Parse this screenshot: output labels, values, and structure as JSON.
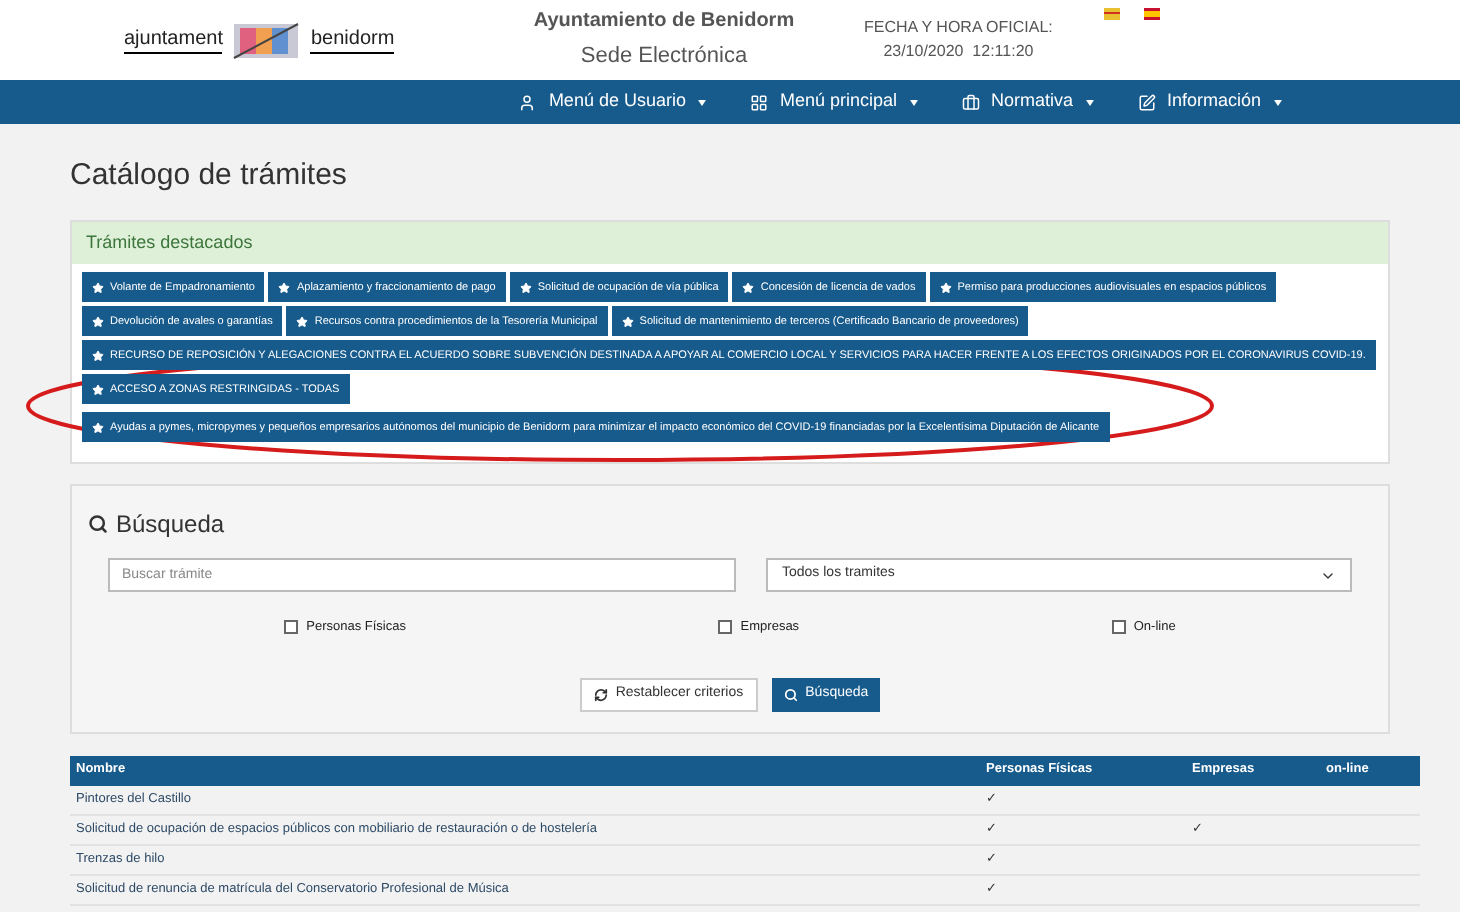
{
  "header": {
    "logo_left": "ajuntament",
    "logo_right": "benidorm",
    "title": "Ayuntamiento de Benidorm",
    "subtitle": "Sede Electrónica",
    "date_label": "FECHA Y HORA OFICIAL:",
    "date_value": "23/10/2020  12:11:20"
  },
  "nav": [
    {
      "label": "Menú de Usuario"
    },
    {
      "label": "Menú principal"
    },
    {
      "label": "Normativa"
    },
    {
      "label": "Información"
    }
  ],
  "page_title": "Catálogo de trámites",
  "featured": {
    "title": "Trámites destacados",
    "items": [
      "Volante de Empadronamiento",
      "Aplazamiento y fraccionamiento de pago",
      "Solicitud de ocupación de vía pública",
      "Concesión de licencia de vados",
      "Permiso para producciones audiovisuales en espacios públicos",
      "Devolución de avales o garantías",
      "Recursos contra procedimientos de la Tesorería Municipal",
      "Solicitud de mantenimiento de terceros (Certificado Bancario de proveedores)",
      "RECURSO DE REPOSICIÓN Y ALEGACIONES CONTRA EL ACUERDO SOBRE SUBVENCIÓN DESTINADA A APOYAR AL COMERCIO LOCAL Y SERVICIOS PARA HACER FRENTE A LOS EFECTOS ORIGINADOS POR EL CORONAVIRUS COVID-19.",
      "ACCESO A ZONAS RESTRINGIDAS - TODAS",
      "Ayudas a pymes, micropymes y pequeños empresarios autónomos del municipio de Benidorm para minimizar el impacto económico del COVID-19 financiadas por la Excelentísima Diputación de Alicante"
    ]
  },
  "search": {
    "title": "Búsqueda",
    "placeholder": "Buscar trámite",
    "select_value": "Todos los tramites",
    "filters": [
      {
        "label": "Personas Físicas",
        "checked": false
      },
      {
        "label": "Empresas",
        "checked": false
      },
      {
        "label": "On-line",
        "checked": false
      }
    ],
    "reset_button": "Restablecer criterios",
    "search_button": "Búsqueda"
  },
  "table": {
    "columns": [
      "Nombre",
      "Personas Físicas",
      "Empresas",
      "on-line"
    ],
    "rows": [
      {
        "name": "Pintores del Castillo",
        "personas": true,
        "empresas": false,
        "online": false
      },
      {
        "name": "Solicitud de ocupación de espacios públicos con mobiliario de restauración o de hostelería",
        "personas": true,
        "empresas": true,
        "online": false
      },
      {
        "name": "Trenzas de hilo",
        "personas": true,
        "empresas": false,
        "online": false
      },
      {
        "name": "Solicitud de renuncia de matrícula del Conservatorio Profesional de Música",
        "personas": true,
        "empresas": false,
        "online": false
      }
    ]
  },
  "check_mark": "✓"
}
